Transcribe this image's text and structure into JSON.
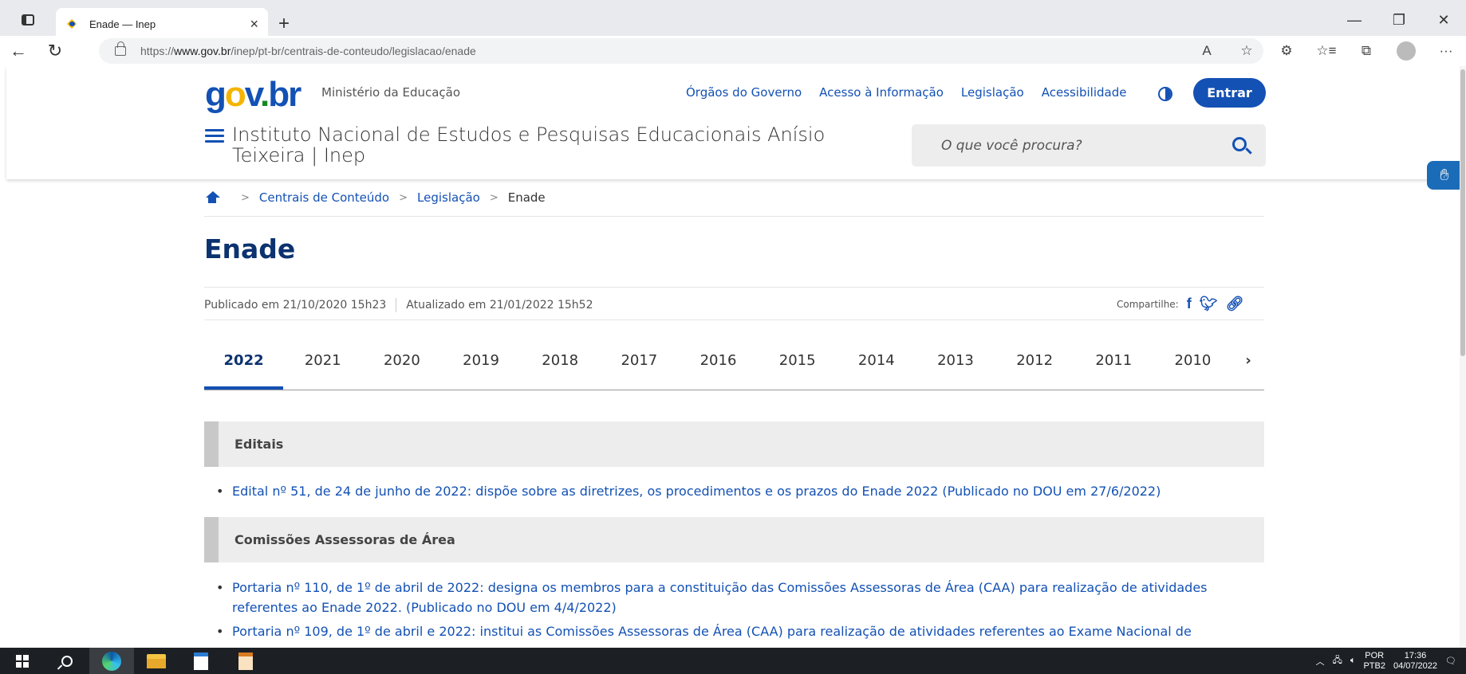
{
  "browser": {
    "tab_title": "Enade — Inep",
    "tab_close": "×",
    "new_tab": "+",
    "url_prefix": "https://",
    "url_host": "www.gov.br",
    "url_path": "/inep/pt-br/centrais-de-conteudo/legislacao/enade",
    "win_minimize": "—",
    "win_restore": "❐",
    "win_close": "✕",
    "back": "←",
    "reload": "↻",
    "read_aloud": "A",
    "fav_add": "☆",
    "extensions": "⚙",
    "favorites": "☆≡",
    "collections": "⧉",
    "more": "···"
  },
  "header": {
    "logo": {
      "g": "g",
      "o": "o",
      "v": "v",
      "dot": ".",
      "br": "br"
    },
    "ministry": "Ministério da Educação",
    "links": [
      "Órgãos do Governo",
      "Acesso à Informação",
      "Legislação",
      "Acessibilidade"
    ],
    "login": "Entrar",
    "institute": "Instituto Nacional de Estudos e Pesquisas Educacionais Anísio Teixeira | Inep",
    "search_placeholder": "O que você procura?"
  },
  "breadcrumb": {
    "items": [
      "Centrais de Conteúdo",
      "Legislação"
    ],
    "current": "Enade",
    "sep": ">"
  },
  "page": {
    "title": "Enade",
    "published": "Publicado em 21/10/2020 15h23",
    "updated": "Atualizado em 21/01/2022 15h52",
    "share_label": "Compartilhe:",
    "share_icons": [
      "facebook-icon",
      "twitter-icon",
      "link-icon"
    ]
  },
  "years": {
    "tabs": [
      "2022",
      "2021",
      "2020",
      "2019",
      "2018",
      "2017",
      "2016",
      "2015",
      "2014",
      "2013",
      "2012",
      "2011",
      "2010"
    ],
    "active": "2022",
    "next": "›"
  },
  "sections": [
    {
      "title": "Editais",
      "items": [
        "Edital nº 51, de 24 de junho de 2022: dispõe sobre as diretrizes, os procedimentos e os prazos do Enade 2022 (Publicado no DOU em 27/6/2022)"
      ]
    },
    {
      "title": "Comissões Assessoras de Área",
      "items": [
        "Portaria nº 110, de 1º de abril de 2022: designa os membros para a constituição das Comissões Assessoras de Área (CAA) para realização de atividades referentes ao Enade 2022. (Publicado no DOU em 4/4/2022)",
        "Portaria nº 109, de 1º de abril e 2022: institui as Comissões Assessoras de Área (CAA) para realização de atividades referentes ao Exame Nacional de"
      ]
    }
  ],
  "taskbar": {
    "lang": "POR",
    "layout": "PTB2",
    "time": "17:36",
    "date": "04/07/2022"
  },
  "colors": {
    "brand_blue": "#1351b4",
    "title_blue": "#0c326f",
    "gov_yellow": "#f5b400",
    "gov_green": "#168821"
  }
}
